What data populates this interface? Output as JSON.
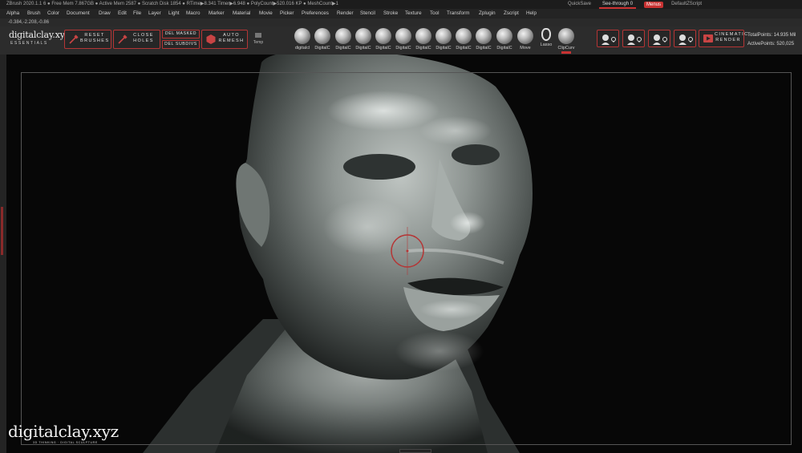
{
  "titlebar": {
    "info": "ZBrush 2020.1.1    6    ● Free Mem 7.867GB ● Active Mem 2587 ● Scratch Disk 1854 ● RTime▶8.341 Timer▶6.948 ● PolyCount▶520.016 KP ● MeshCount▶1",
    "quicksave": "QuickSave",
    "see_through": "See-through  0",
    "menus": "Menus",
    "default_zscript": "DefaultZScript"
  },
  "menus": [
    "Alpha",
    "Brush",
    "Color",
    "Document",
    "Draw",
    "Edit",
    "File",
    "Layer",
    "Light",
    "Macro",
    "Marker",
    "Material",
    "Movie",
    "Picker",
    "Preferences",
    "Render",
    "Stencil",
    "Stroke",
    "Texture",
    "Tool",
    "Transform",
    "Zplugin",
    "Zscript",
    "Help"
  ],
  "coords": "-0.384,-2.208,-0.86",
  "logo": {
    "main": "digitalclay.xyz",
    "sub": "ESSENTIALS"
  },
  "buttons": {
    "reset_brushes_1": "RESET",
    "reset_brushes_2": "BRUSHES",
    "close_holes_1": "CLOSE",
    "close_holes_2": "HOLES",
    "del_masked": "DEL MASKED",
    "del_subdivs": "DEL SUBDIVS",
    "auto_remesh_1": "AUTO",
    "auto_remesh_2": "REMESH",
    "temp": "Temp",
    "cinematic_1": "CINEMATIC",
    "cinematic_2": "RENDER"
  },
  "brushes": [
    "digitalcl",
    "DigitalC",
    "DigitalC",
    "DigitalC",
    "DigitalC",
    "DigitalC",
    "DigitalC",
    "DigitalC",
    "DigitalC",
    "DigitalC",
    "DigitalC",
    "Move",
    "Lasso",
    "ClipCurv"
  ],
  "stats": {
    "total": "TotalPoints: 14.935 Mil",
    "active": "ActivePoints: 520,025"
  },
  "watermark": {
    "main": "digitalclay.xyz",
    "tag": "3D THINKING · DIGITAL SCULPTURE"
  },
  "colors": {
    "accent": "#c83232",
    "canvas": "#070707",
    "toolbar": "#2c2c2c"
  }
}
